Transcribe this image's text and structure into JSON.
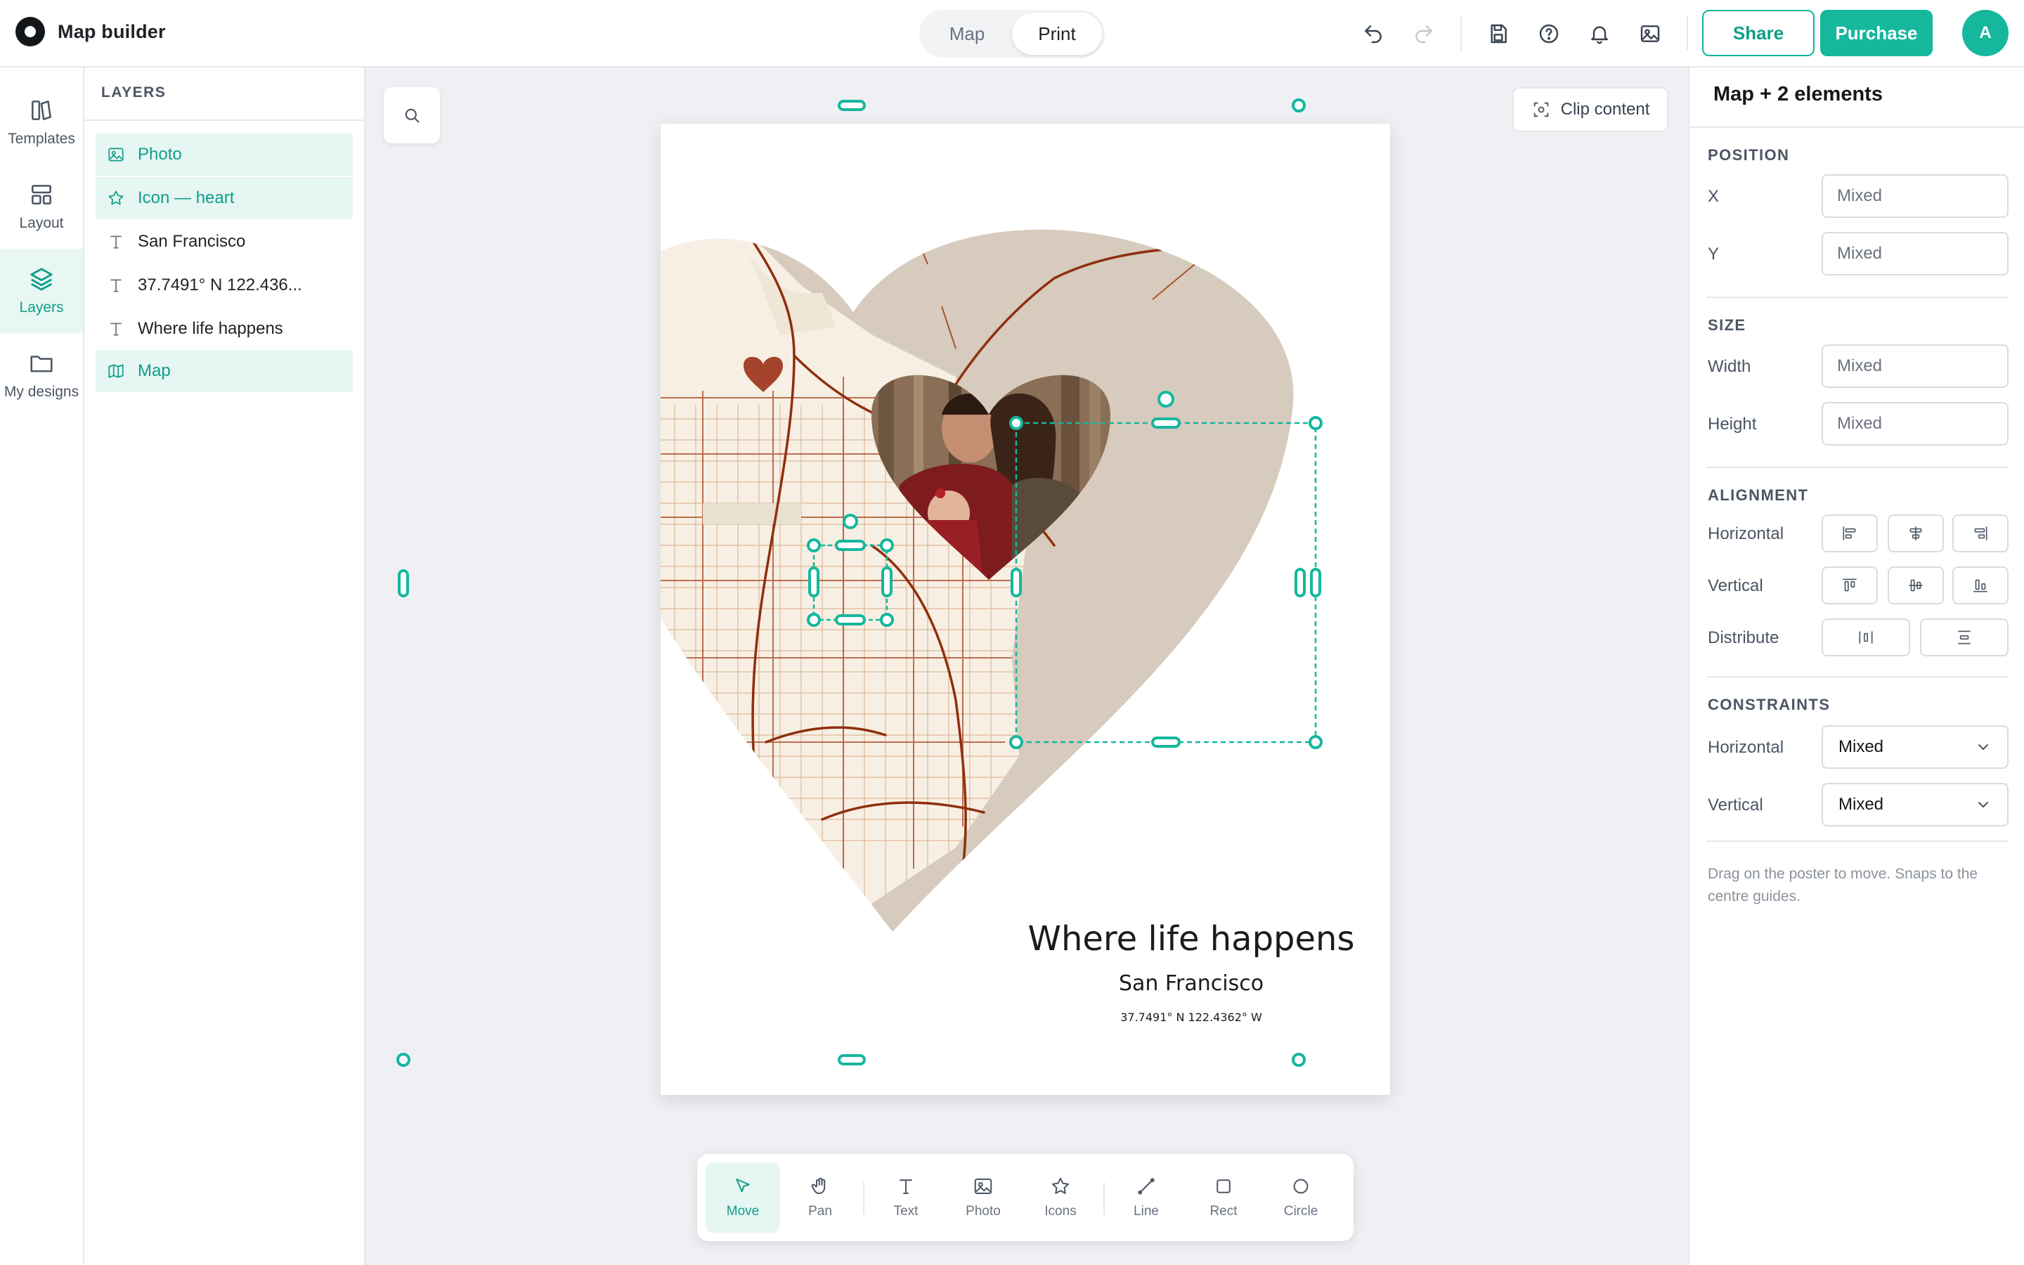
{
  "app": {
    "title": "Map builder"
  },
  "mode_toggle": {
    "options": [
      "Map",
      "Print"
    ],
    "active": "Print"
  },
  "header": {
    "share_label": "Share",
    "purchase_label": "Purchase",
    "avatar_initial": "A"
  },
  "rail": {
    "items": [
      {
        "label": "Templates",
        "icon": "templates-icon"
      },
      {
        "label": "Layout",
        "icon": "layout-icon"
      },
      {
        "label": "Layers",
        "icon": "layers-icon",
        "active": true
      },
      {
        "label": "My designs",
        "icon": "folder-icon"
      }
    ]
  },
  "layers_panel": {
    "header": "LAYERS",
    "items": [
      {
        "label": "Photo",
        "icon": "image-icon",
        "selected": true
      },
      {
        "label": "Icon — heart",
        "icon": "star-icon",
        "selected": true
      },
      {
        "label": "San Francisco",
        "icon": "text-icon",
        "selected": false
      },
      {
        "label": "37.7491° N 122.436...",
        "icon": "text-icon",
        "selected": false
      },
      {
        "label": "Where life happens",
        "icon": "text-icon",
        "selected": false
      },
      {
        "label": "Map",
        "icon": "map-icon",
        "selected": true
      }
    ]
  },
  "canvas": {
    "clip_label": "Clip content"
  },
  "poster": {
    "title": "Where life happens",
    "subtitle": "San Francisco",
    "coordinates": "37.7491° N  122.4362° W"
  },
  "tools": {
    "items": [
      {
        "label": "Move",
        "icon": "cursor-icon",
        "active": true
      },
      {
        "label": "Pan",
        "icon": "hand-icon"
      },
      {
        "label": "Text",
        "icon": "text-icon"
      },
      {
        "label": "Photo",
        "icon": "image-icon"
      },
      {
        "label": "Icons",
        "icon": "star-icon"
      },
      {
        "label": "Line",
        "icon": "line-icon"
      },
      {
        "label": "Rect",
        "icon": "square-icon"
      },
      {
        "label": "Circle",
        "icon": "circle-icon"
      }
    ]
  },
  "inspector": {
    "title": "Map + 2 elements",
    "position": {
      "header": "POSITION",
      "x_label": "X",
      "x_value": "Mixed",
      "y_label": "Y",
      "y_value": "Mixed"
    },
    "size": {
      "header": "SIZE",
      "width_label": "Width",
      "width_value": "Mixed",
      "height_label": "Height",
      "height_value": "Mixed"
    },
    "alignment": {
      "header": "ALIGNMENT",
      "horizontal_label": "Horizontal",
      "vertical_label": "Vertical",
      "distribute_label": "Distribute"
    },
    "constraints": {
      "header": "CONSTRAINTS",
      "horizontal_label": "Horizontal",
      "horizontal_value": "Mixed",
      "vertical_label": "Vertical",
      "vertical_value": "Mixed"
    },
    "hint": "Drag on the poster to move. Snaps to the centre guides."
  },
  "colors": {
    "accent": "#15b79d",
    "map_land": "#d6cbbd",
    "map_city": "#f7efe3",
    "roads": "#9b3a14",
    "heart_pin": "#a5432c"
  }
}
